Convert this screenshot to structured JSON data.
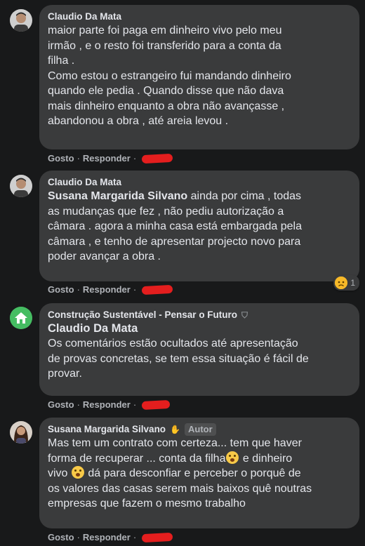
{
  "comments": [
    {
      "author": "Claudio Da Mata",
      "text": "maior parte foi paga em dinheiro vivo pelo meu\nirmão , e o resto foi transferido para a conta da\nfilha .\nComo estou o estrangeiro fui mandando dinheiro\nquando ele pedia . Quando disse que não dava\nmais dinheiro enquanto a obra não avançasse ,\nabandonou a obra , até areia levou .",
      "like": "Gosto",
      "reply": "Responder"
    },
    {
      "author": "Claudio Da Mata",
      "mention": "Susana Margarida Silvano",
      "text_after_mention": " ainda por cima , todas\nas mudanças que fez , não pediu autorização a\ncâmara . agora a minha casa está embargada pela\ncâmara , e tenho de apresentar projecto novo para\npoder avançar a obra .",
      "like": "Gosto",
      "reply": "Responder",
      "reaction_count": "1"
    },
    {
      "author": "Construção Sustentável - Pensar o Futuro",
      "mention": "Claudio Da Mata",
      "text": "Os comentários estão ocultados até apresentação\nde provas concretas, se tem essa situação é fácil de\nprovar.",
      "like": "Gosto",
      "reply": "Responder"
    },
    {
      "author": "Susana Margarida Silvano",
      "badge": "Autor",
      "text_part1": "Mas tem um contrato com certeza... tem que haver\nforma de recuperar ... conta da filha",
      "text_part2": " e dinheiro\nvivo ",
      "text_part3": " dá para desconfiar e perceber o porquê de\nos valores das casas serem mais baixos quê noutras\nempresas que fazem o mesmo trabalho",
      "like": "Gosto",
      "reply": "Responder"
    }
  ],
  "separator": "·",
  "colors": {
    "background": "#18191a",
    "bubble": "#3a3b3c",
    "redaction": "#e41e1e",
    "page_avatar": "#45bd62"
  }
}
